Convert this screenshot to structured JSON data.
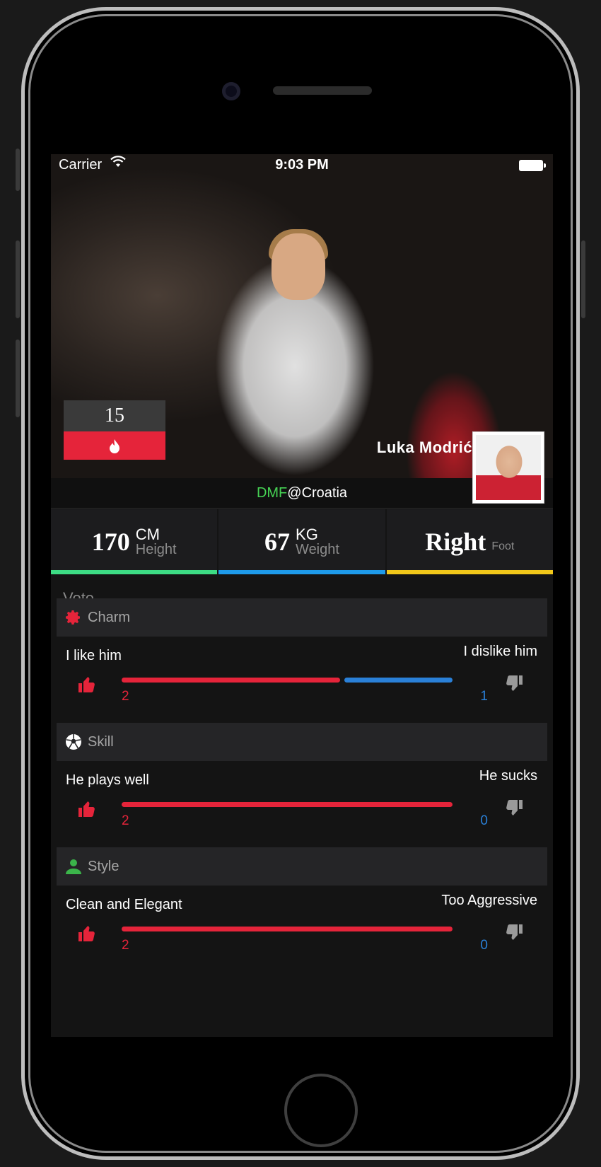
{
  "status_bar": {
    "carrier": "Carrier",
    "time": "9:03 PM"
  },
  "player": {
    "rank": "15",
    "name": "Luka Modrić",
    "position_code": "DMF",
    "position_team": "@Croatia"
  },
  "stats": [
    {
      "value": "170",
      "unit": "CM",
      "label": "Height",
      "color": "#3ddc84"
    },
    {
      "value": "67",
      "unit": "KG",
      "label": "Weight",
      "color": "#1e9bea"
    },
    {
      "value": "Right",
      "unit": "",
      "label": "Foot",
      "color": "#f2c81a"
    }
  ],
  "vote": {
    "title": "Vote",
    "sections": [
      {
        "category": "Charm",
        "icon": "gear-icon",
        "icon_color": "#e5243a",
        "like_text": "I like him",
        "dislike_text": "I dislike him",
        "like_count": "2",
        "dislike_count": "1",
        "like_fraction": 0.667
      },
      {
        "category": "Skill",
        "icon": "soccer-ball-icon",
        "icon_color": "#ffffff",
        "like_text": "He plays well",
        "dislike_text": "He sucks",
        "like_count": "2",
        "dislike_count": "0",
        "like_fraction": 1.0
      },
      {
        "category": "Style",
        "icon": "person-icon",
        "icon_color": "#3bb54a",
        "like_text": "Clean and Elegant",
        "dislike_text": "Too Aggressive",
        "like_count": "2",
        "dislike_count": "0",
        "like_fraction": 1.0
      }
    ]
  }
}
